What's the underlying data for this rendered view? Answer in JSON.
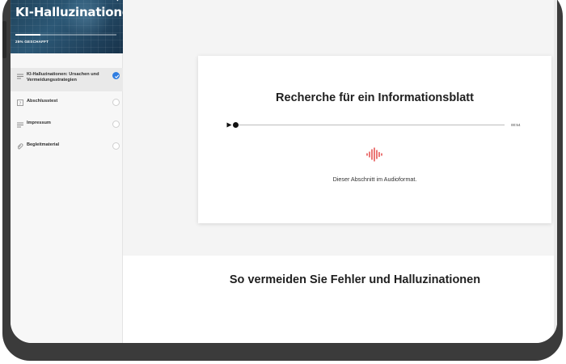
{
  "course": {
    "title": "KI-Halluzinationen",
    "progress_label": "25% GESCHAFFT",
    "progress_fraction": 0.25
  },
  "sidebar": {
    "items": [
      {
        "label": "KI-Halluzinationen: Ursachen und Vermeidungsstrategien",
        "icon": "lines-icon",
        "status": "completed"
      },
      {
        "label": "Abschlusstest",
        "icon": "quiz-icon",
        "status": "not-started"
      },
      {
        "label": "Impressum",
        "icon": "lines-icon",
        "status": "not-started"
      },
      {
        "label": "Begleitmaterial",
        "icon": "attachment-icon",
        "status": "not-started"
      }
    ]
  },
  "lesson": {
    "card_title": "Recherche für ein Informationsblatt",
    "audio_duration": "00:54",
    "audio_caption": "Dieser Abschnitt im Audioformat.",
    "section_heading": "So vermeiden Sie Fehler und Halluzinationen"
  },
  "colors": {
    "accent": "#2f7de1",
    "audio_icon": "#e0302e",
    "hero_background": "#1e3f56"
  }
}
